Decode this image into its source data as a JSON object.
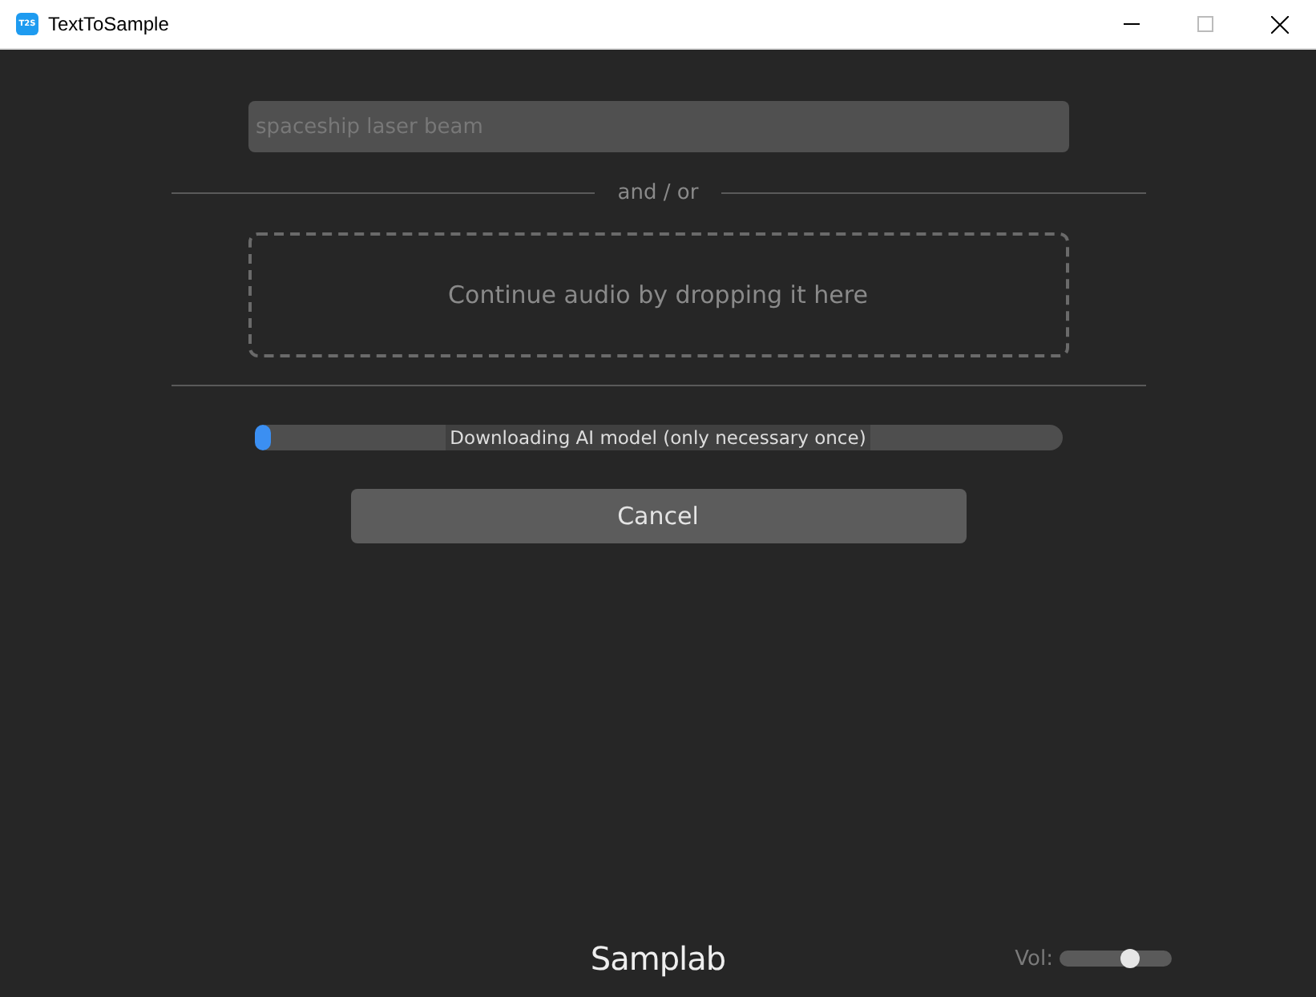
{
  "window": {
    "icon_label": "T2S",
    "title": "TextToSample"
  },
  "prompt": {
    "placeholder": "spaceship laser beam"
  },
  "separator": {
    "label": "and / or"
  },
  "drop_zone": {
    "label": "Continue audio by dropping it here"
  },
  "progress": {
    "level": 0.02,
    "label": "Downloading AI model (only necessary once)"
  },
  "cancel_button": {
    "label": "Cancel"
  },
  "footer": {
    "brand": "Samplab",
    "volume": {
      "label": "Vol:",
      "level": 0.63
    }
  }
}
